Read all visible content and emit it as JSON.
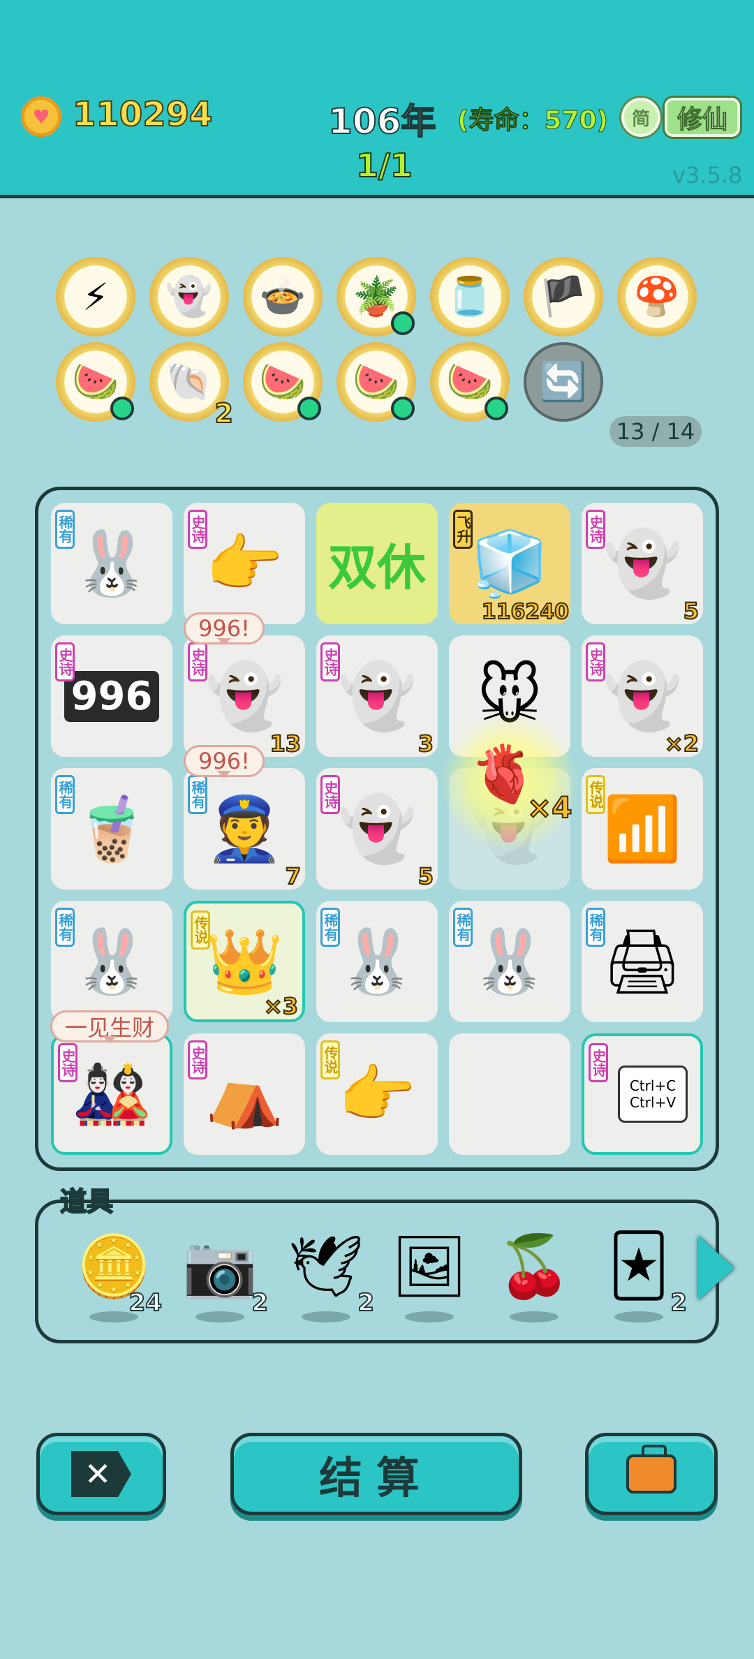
{
  "header": {
    "coins": "110294",
    "year": "106年",
    "lifespan": "(寿命：570)",
    "stage": "1/1",
    "lang_button": "简",
    "cultivate_button": "修仙",
    "version": "v3.5.8"
  },
  "relics": {
    "row1": [
      {
        "icon": "lightning-icon"
      },
      {
        "icon": "ghost-icon"
      },
      {
        "icon": "pot-duck-icon"
      },
      {
        "icon": "flower-pot-icon"
      },
      {
        "icon": "jar-icon"
      },
      {
        "icon": "eye-patch-icon"
      },
      {
        "icon": "mushroom-cloud-icon"
      }
    ],
    "row2": [
      {
        "icon": "fruit-platter-icon"
      },
      {
        "icon": "shell-icon",
        "count": "2"
      },
      {
        "icon": "fruit-platter-icon"
      },
      {
        "icon": "fruit-platter-icon"
      },
      {
        "icon": "fruit-platter-icon"
      },
      {
        "icon": "refresh-icon"
      }
    ],
    "counter": "13 / 14"
  },
  "board": {
    "cells": [
      {
        "tag": "稀有",
        "icon": "rabbit-icon"
      },
      {
        "tag": "史诗",
        "icon": "pointing-hand-icon"
      },
      {
        "tag": "",
        "icon": "double-rest-icon",
        "text": "双休"
      },
      {
        "tag": "飞升",
        "icon": "fridge-6g-icon",
        "value": "116240"
      },
      {
        "tag": "史诗",
        "icon": "ghost-icon",
        "count": "5"
      },
      {
        "tag": "史诗",
        "icon": "996-counter-icon",
        "text": "996"
      },
      {
        "tag": "史诗",
        "icon": "ghost-icon",
        "count": "13"
      },
      {
        "tag": "史诗",
        "icon": "ghost-icon",
        "count": "3"
      },
      {
        "tag": "",
        "icon": "rat-icon"
      },
      {
        "tag": "史诗",
        "icon": "ghost-icon",
        "count": "×2"
      },
      {
        "tag": "稀有",
        "icon": "bubble-tea-icon"
      },
      {
        "tag": "稀有",
        "icon": "police-icon",
        "count": "7"
      },
      {
        "tag": "史诗",
        "icon": "ghost-icon",
        "count": "5"
      },
      {
        "tag": "",
        "icon": "ghost-faded-icon"
      },
      {
        "tag": "传说",
        "icon": "wifi-icon"
      },
      {
        "tag": "稀有",
        "icon": "rabbit-icon"
      },
      {
        "tag": "传说",
        "icon": "king-fridge-icon",
        "count": "×3"
      },
      {
        "tag": "稀有",
        "icon": "rabbit-icon"
      },
      {
        "tag": "稀有",
        "icon": "rabbit-icon"
      },
      {
        "tag": "稀有",
        "icon": "printer-icon"
      },
      {
        "tag": "史诗",
        "icon": "white-black-impermanence-icon"
      },
      {
        "tag": "史诗",
        "icon": "rabbit-house-icon"
      },
      {
        "tag": "传说",
        "icon": "yellow-hand-icon"
      },
      {
        "tag": "",
        "icon": ""
      },
      {
        "tag": "史诗",
        "icon": "ctrl-cv-icon",
        "text": "Ctrl+C Ctrl+V"
      }
    ],
    "bubbles": [
      "996!",
      "996!",
      "一见生财"
    ],
    "effect": {
      "icon": "liver-icon",
      "multiplier": "×4"
    }
  },
  "items": {
    "title": "道具",
    "list": [
      {
        "icon": "dollar-coin-icon",
        "count": "24"
      },
      {
        "icon": "camera-icon",
        "count": "2"
      },
      {
        "icon": "pigeon-icon",
        "count": "2"
      },
      {
        "icon": "frame-icon",
        "count": ""
      },
      {
        "icon": "lychee-icon",
        "count": ""
      },
      {
        "icon": "rare-cards-icon",
        "count": "2"
      }
    ]
  },
  "buttons": {
    "settle": "结算"
  }
}
